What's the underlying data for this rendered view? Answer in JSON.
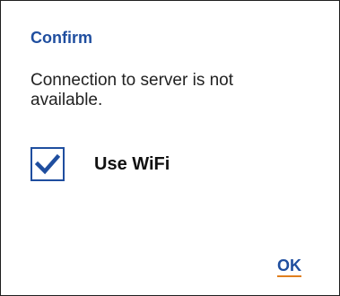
{
  "dialog": {
    "title": "Confirm",
    "message": "Connection to server is not available.",
    "checkbox": {
      "label": "Use WiFi",
      "checked": true
    },
    "ok_label": "OK"
  },
  "colors": {
    "accent": "#1f4e9f",
    "underline": "#e07f1e",
    "text": "#222222"
  },
  "icons": {
    "checkbox": "checkmark-icon"
  }
}
